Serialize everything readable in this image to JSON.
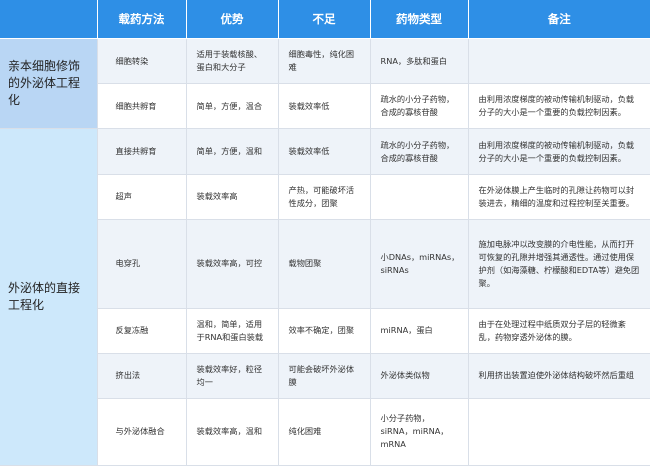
{
  "headers": [
    "",
    "载药方法",
    "优势",
    "不足",
    "药物类型",
    "备注"
  ],
  "groups": [
    {
      "label": "亲本细胞修饰的外泌体工程化",
      "rows": [
        {
          "method": "细胞转染",
          "advantage": "适用于装载核酸、蛋白和大分子",
          "disadvantage": "细胞毒性，纯化困难",
          "drug_type": "RNA，多肽和蛋白",
          "note": ""
        },
        {
          "method": "细胞共孵育",
          "advantage": "简单，方便，温合",
          "disadvantage": "装载效率低",
          "drug_type": "疏水的小分子药物，合成的寡核苷酸",
          "note": "由利用浓度梯度的被动传输机制驱动，负载分子的大小是一个重要的负载控制因素。"
        }
      ]
    },
    {
      "label": "外泌体的直接工程化",
      "rows": [
        {
          "method": "直接共孵育",
          "advantage": "简单，方便，温和",
          "disadvantage": "装载效率低",
          "drug_type": "疏水的小分子药物，合成的寡核苷酸",
          "note": "由利用浓度梯度的被动传输机制驱动，负载分子的大小是一个重要的负载控制因素。"
        },
        {
          "method": "超声",
          "advantage": "装载效率高",
          "disadvantage": "产热，可能破坏活性成分，团聚",
          "drug_type": "",
          "note": "在外泌体膜上产生临时的孔隙让药物可以封装进去，精细的温度和过程控制至关重要。"
        },
        {
          "method": "电穿孔",
          "advantage": "装载效率高，可控",
          "disadvantage": "载物团聚",
          "drug_type": "小DNAs，miRNAs，siRNAs",
          "note": "施加电脉冲以改变膜的介电性能，从而打开可恢复的孔隙并增强其通透性。通过使用保护剂（如海藻糖、柠檬酸和EDTA等）避免团聚。"
        },
        {
          "method": "反复冻融",
          "advantage": "温和，简单，适用于RNA和蛋白装载",
          "disadvantage": "效率不确定，团聚",
          "drug_type": "miRNA，蛋白",
          "note": "由于在处理过程中纸质双分子层的轻微紊乱，药物穿透外泌体的膜。"
        },
        {
          "method": "挤出法",
          "advantage": "装载效率好，粒径均一",
          "disadvantage": "可能会破坏外泌体膜",
          "drug_type": "外泌体类似物",
          "note": "利用挤出装置迫使外泌体结构破坏然后重组"
        },
        {
          "method": "与外泌体融合",
          "advantage": "装载效率高，温和",
          "disadvantage": "纯化困难",
          "drug_type": "小分子药物，siRNA，miRNA，mRNA",
          "note": ""
        }
      ]
    }
  ]
}
